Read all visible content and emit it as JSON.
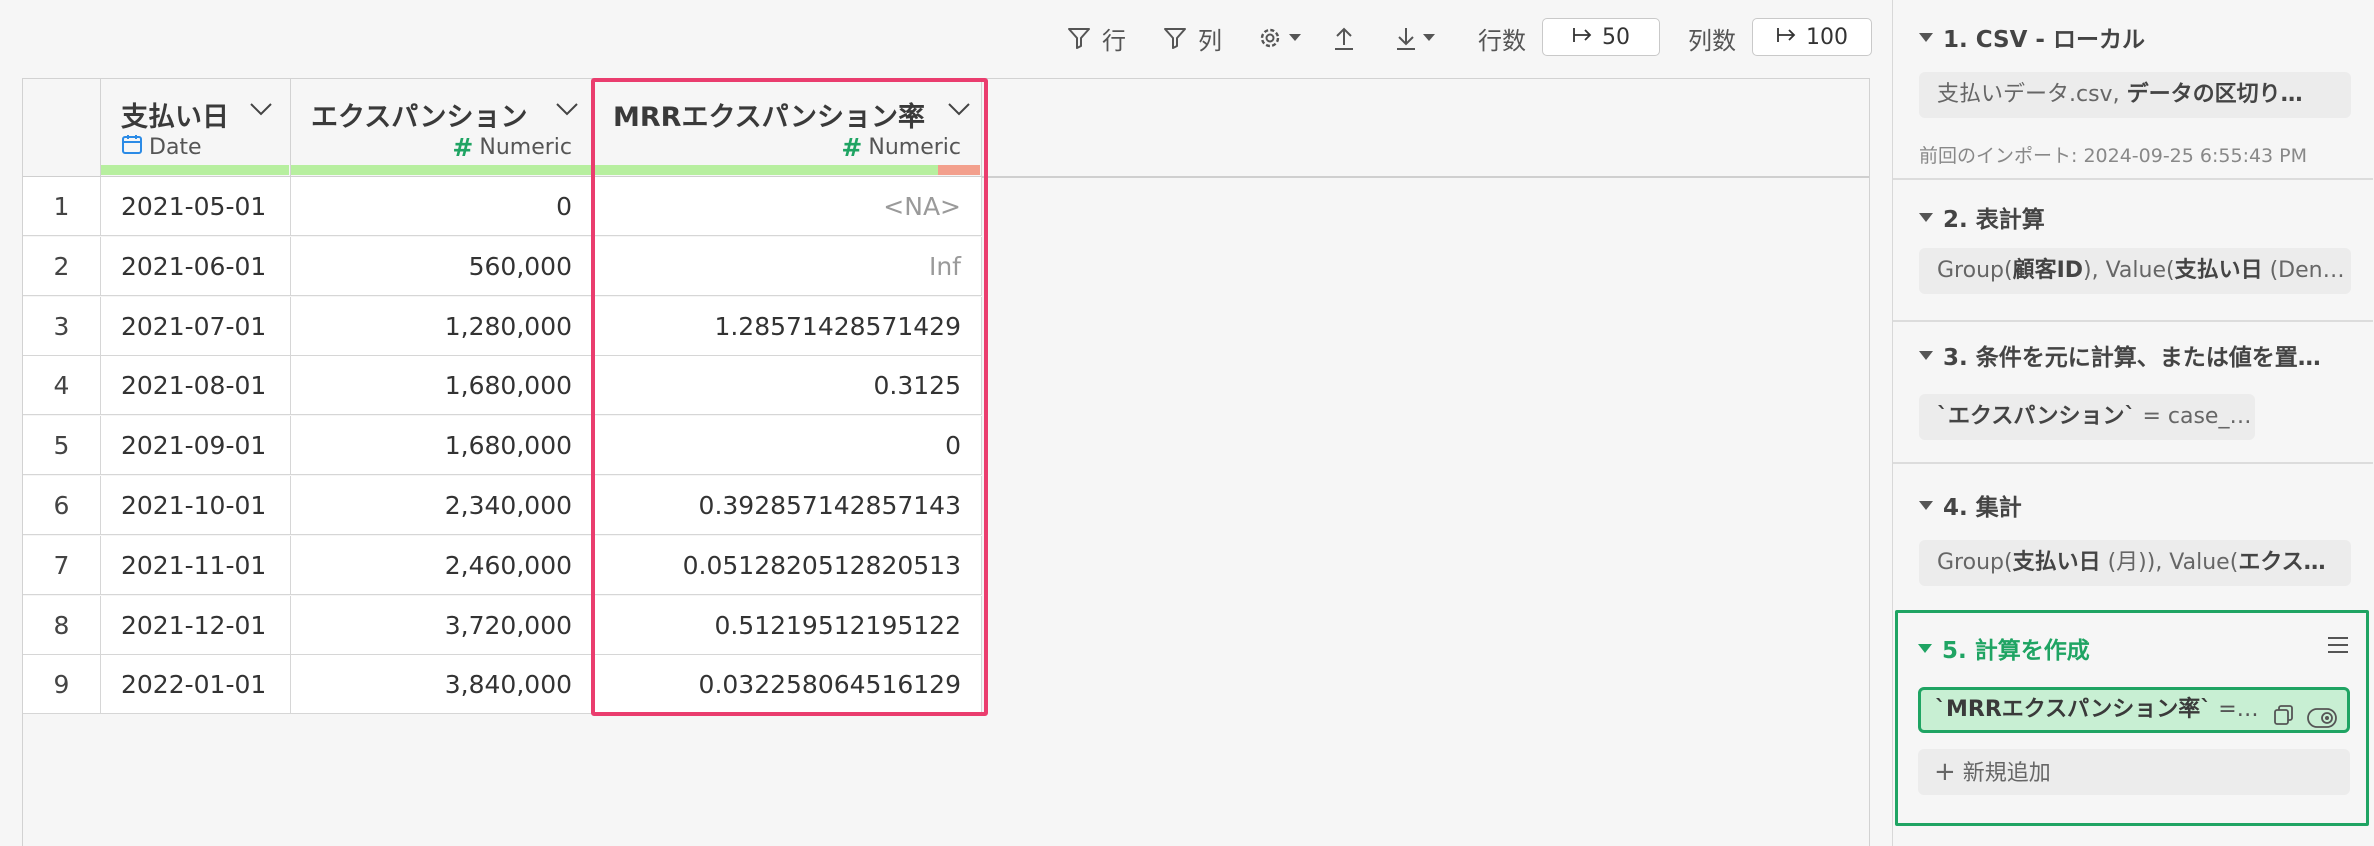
{
  "toolbar": {
    "row_filter_label": "行",
    "col_filter_label": "列",
    "rows_label": "行数",
    "rows_value": "50",
    "cols_label": "列数",
    "cols_value": "100"
  },
  "columns": [
    {
      "name": "支払い日",
      "type": "Date"
    },
    {
      "name": "エクスパンション",
      "type": "Numeric"
    },
    {
      "name": "MRRエクスパンション率",
      "type": "Numeric"
    }
  ],
  "rows": [
    {
      "idx": "1",
      "date": "2021-05-01",
      "exp": "0",
      "mrr": "<NA>"
    },
    {
      "idx": "2",
      "date": "2021-06-01",
      "exp": "560,000",
      "mrr": "Inf"
    },
    {
      "idx": "3",
      "date": "2021-07-01",
      "exp": "1,280,000",
      "mrr": "1.28571428571429"
    },
    {
      "idx": "4",
      "date": "2021-08-01",
      "exp": "1,680,000",
      "mrr": "0.3125"
    },
    {
      "idx": "5",
      "date": "2021-09-01",
      "exp": "1,680,000",
      "mrr": "0"
    },
    {
      "idx": "6",
      "date": "2021-10-01",
      "exp": "2,340,000",
      "mrr": "0.392857142857143"
    },
    {
      "idx": "7",
      "date": "2021-11-01",
      "exp": "2,460,000",
      "mrr": "0.0512820512820513"
    },
    {
      "idx": "8",
      "date": "2021-12-01",
      "exp": "3,720,000",
      "mrr": "0.51219512195122"
    },
    {
      "idx": "9",
      "date": "2022-01-01",
      "exp": "3,840,000",
      "mrr": "0.032258064516129"
    }
  ],
  "steps": {
    "s1_title": "1. CSV - ローカル",
    "s1_a": "支払いデータ.csv, ",
    "s1_b": "データの区切り…",
    "s1_note": "前回のインポート: 2024-09-25 6:55:43 PM",
    "s2_title": "2. 表計算",
    "s2_a": "Group(",
    "s2_b": "顧客ID",
    "s2_c": "), Value(",
    "s2_d": "支払い日",
    "s2_e": " (Den…",
    "s3_title": "3. 条件を元に計算、または値を置…",
    "s3_a": "`エクスパンション`",
    "s3_b": " = case_…",
    "s4_title": "4. 集計",
    "s4_a": "Group(",
    "s4_b": "支払い日",
    "s4_c": " (月)), Value(",
    "s4_d": "エクス…",
    "s5_title": "5. 計算を作成",
    "s5_item": "`MRRエクスパンション率`",
    "s5_item_tail": " =…",
    "add_new": "新規追加"
  },
  "colors": {
    "accent_pink": "#ea3d6e",
    "accent_green": "#1fa463",
    "quality_green": "#b7ef9f",
    "quality_red": "#f3a08d",
    "date_blue": "#2b8be6"
  }
}
